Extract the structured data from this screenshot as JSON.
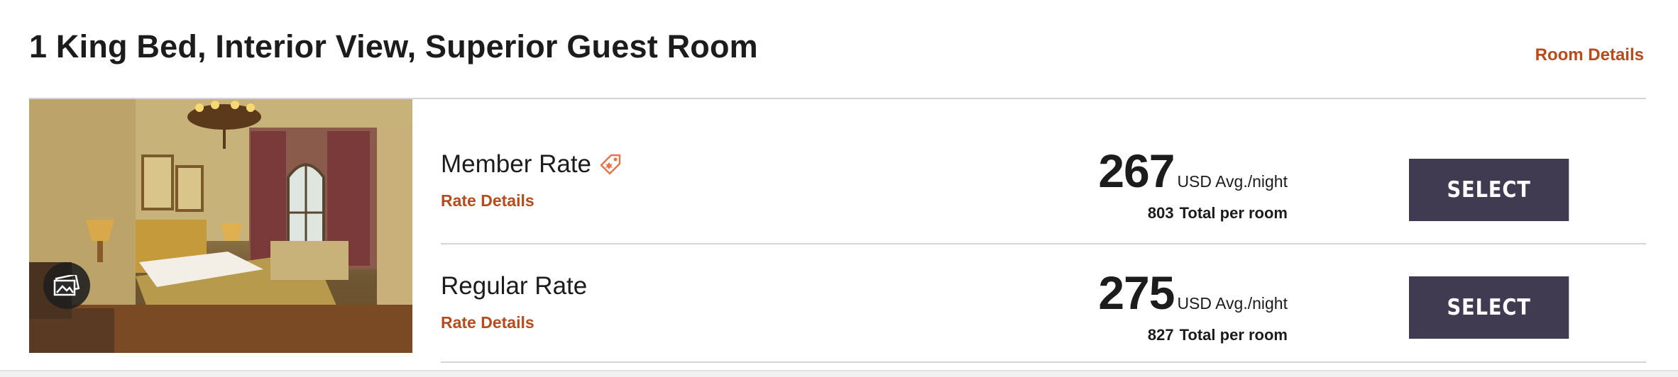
{
  "room": {
    "title": "1 King Bed, Interior View, Superior Guest Room",
    "details_link": "Room Details",
    "photo_icon": "gallery-icon"
  },
  "rates": [
    {
      "name": "Member Rate",
      "tag_icon": "tag-icon",
      "details_link": "Rate Details",
      "price": "267",
      "unit": "USD Avg./night",
      "total": "803",
      "total_label": "Total per room",
      "button": "SELECT"
    },
    {
      "name": "Regular Rate",
      "details_link": "Rate Details",
      "price": "275",
      "unit": "USD Avg./night",
      "total": "827",
      "total_label": "Total per room",
      "button": "SELECT"
    }
  ],
  "colors": {
    "accent": "#b94a1b",
    "button_bg": "#403b50",
    "tag_icon": "#e8744a"
  }
}
